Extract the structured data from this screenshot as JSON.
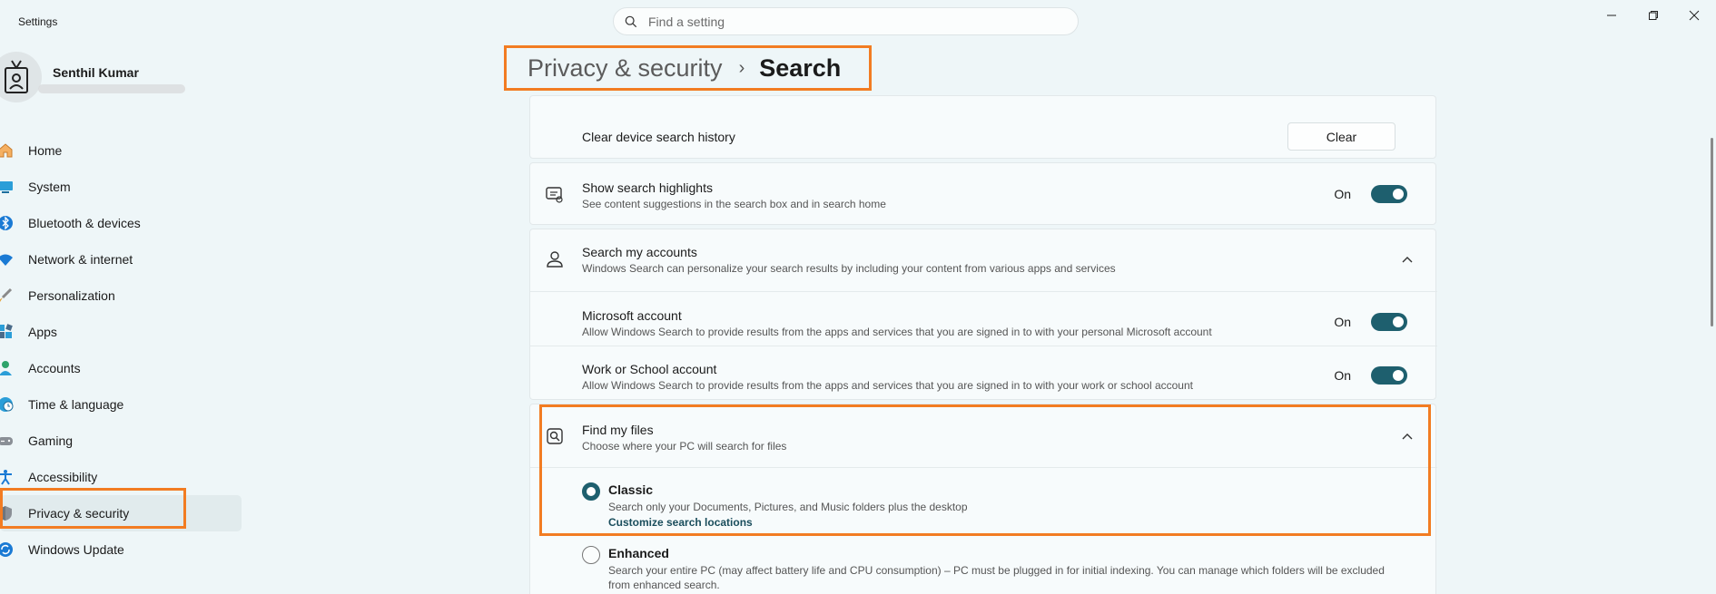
{
  "window": {
    "title": "Settings"
  },
  "search": {
    "placeholder": "Find a setting"
  },
  "profile": {
    "name": "Senthil Kumar"
  },
  "sidebar": {
    "items": [
      {
        "label": "Home",
        "icon": "home-icon"
      },
      {
        "label": "System",
        "icon": "monitor-icon"
      },
      {
        "label": "Bluetooth & devices",
        "icon": "bluetooth-icon"
      },
      {
        "label": "Network & internet",
        "icon": "wifi-icon"
      },
      {
        "label": "Personalization",
        "icon": "brush-icon"
      },
      {
        "label": "Apps",
        "icon": "apps-icon"
      },
      {
        "label": "Accounts",
        "icon": "person-icon"
      },
      {
        "label": "Time & language",
        "icon": "globe-clock-icon"
      },
      {
        "label": "Gaming",
        "icon": "gamepad-icon"
      },
      {
        "label": "Accessibility",
        "icon": "accessibility-icon"
      },
      {
        "label": "Privacy & security",
        "icon": "shield-icon",
        "selected": true
      },
      {
        "label": "Windows Update",
        "icon": "update-icon"
      }
    ]
  },
  "breadcrumb": {
    "parent": "Privacy & security",
    "separator": "›",
    "current": "Search"
  },
  "content": {
    "clear_history": {
      "title": "Clear device search history",
      "button": "Clear"
    },
    "highlights": {
      "title": "Show search highlights",
      "desc": "See content suggestions in the search box and in search home",
      "state": "On"
    },
    "accounts": {
      "title": "Search my accounts",
      "desc": "Windows Search can personalize your search results by including your content from various apps and services",
      "microsoft": {
        "title": "Microsoft account",
        "desc": "Allow Windows Search to provide results from the apps and services that you are signed in to with your personal Microsoft account",
        "state": "On"
      },
      "work": {
        "title": "Work or School account",
        "desc": "Allow Windows Search to provide results from the apps and services that you are signed in to with your work or school account",
        "state": "On"
      }
    },
    "find_files": {
      "title": "Find my files",
      "desc": "Choose where your PC will search for files",
      "classic": {
        "title": "Classic",
        "desc": "Search only your Documents, Pictures, and Music folders plus the desktop",
        "link": "Customize search locations",
        "checked": true
      },
      "enhanced": {
        "title": "Enhanced",
        "desc": "Search your entire PC (may affect battery life and CPU consumption) – PC must be plugged in for initial indexing. You can manage which folders will be excluded from enhanced search.",
        "checked": false
      }
    }
  },
  "colors": {
    "accent": "#1e5f6e",
    "highlight": "#f27c22",
    "background": "#eef6f8"
  }
}
